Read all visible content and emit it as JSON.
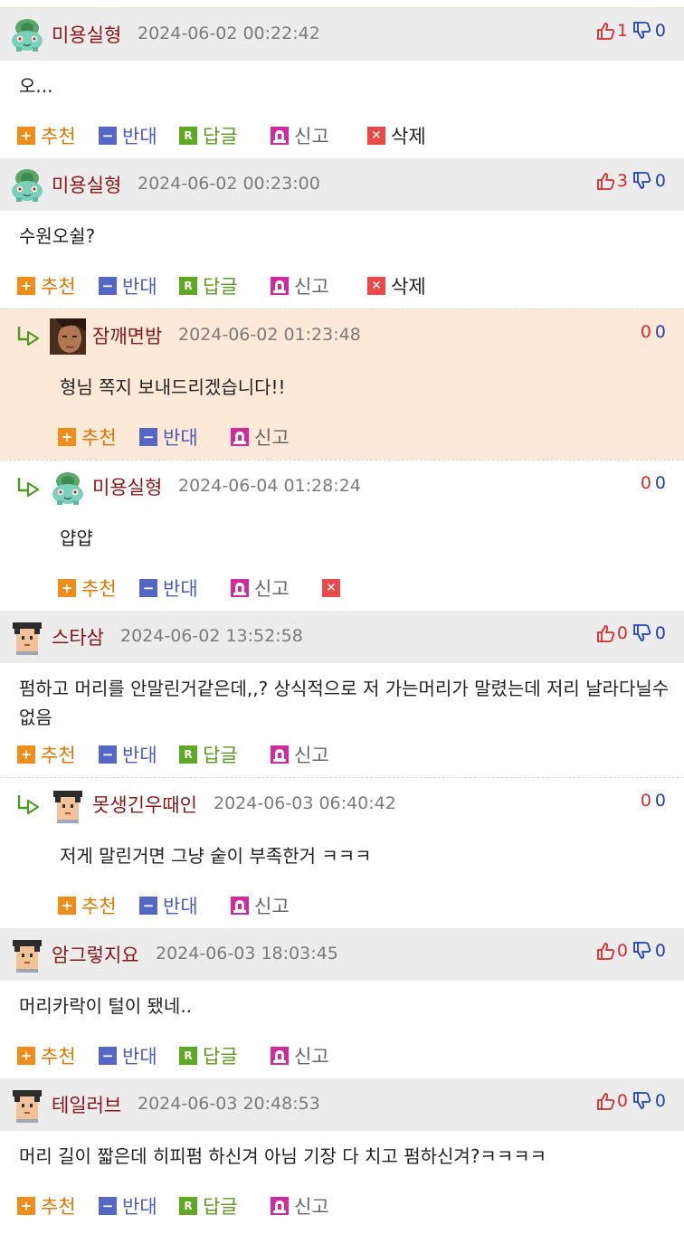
{
  "actions": {
    "recommend": "추천",
    "oppose": "반대",
    "reply": "답글",
    "report": "신고",
    "delete": "삭제"
  },
  "colors": {
    "recommend": "#ef8c1a",
    "oppose": "#5566c4",
    "reply": "#5ea823",
    "report": "#d12a9e",
    "delete": "#e84a4a",
    "nickname": "#8a1515",
    "highlight_bg": "#fde9d7"
  },
  "comments": [
    {
      "nick": "미용실형",
      "date": "2024-06-02 00:22:42",
      "text": "오...",
      "up": "1",
      "down": "0",
      "avatar": "pokemon-avatar-icon",
      "reply": false,
      "highlight": false,
      "showThumbs": true,
      "showReply": true,
      "del": "label"
    },
    {
      "nick": "미용실형",
      "date": "2024-06-02 00:23:00",
      "text": "수원오쉴?",
      "up": "3",
      "down": "0",
      "avatar": "pokemon-avatar-icon",
      "reply": false,
      "highlight": false,
      "showThumbs": true,
      "showReply": true,
      "del": "label"
    },
    {
      "nick": "잠깨면밤",
      "date": "2024-06-02 01:23:48",
      "text": "형님 쪽지 보내드리겠습니다!!",
      "up": "0",
      "down": "0",
      "avatar": "photo-avatar-icon",
      "reply": true,
      "highlight": true,
      "showThumbs": false,
      "showReply": false,
      "del": "none"
    },
    {
      "nick": "미용실형",
      "date": "2024-06-04 01:28:24",
      "text": "얍얍",
      "up": "0",
      "down": "0",
      "avatar": "pokemon-avatar-icon",
      "reply": true,
      "highlight": false,
      "showThumbs": false,
      "showReply": false,
      "del": "icon"
    },
    {
      "nick": "스타삼",
      "date": "2024-06-02 13:52:58",
      "text": "펌하고 머리를 안말린거같은데,,? 상식적으로 저 가는머리가 말렸는데 저리 날라다닐수 없음",
      "up": "0",
      "down": "0",
      "avatar": "pixel-person-avatar-icon",
      "reply": false,
      "highlight": false,
      "showThumbs": true,
      "showReply": true,
      "del": "none"
    },
    {
      "nick": "못생긴우때인",
      "date": "2024-06-03 06:40:42",
      "text": "저게 말린거면 그냥 숱이 부족한거 ㅋㅋㅋ",
      "up": "0",
      "down": "0",
      "avatar": "pixel-person-avatar-icon",
      "reply": true,
      "highlight": false,
      "showThumbs": false,
      "showReply": false,
      "del": "none"
    },
    {
      "nick": "암그렇지요",
      "date": "2024-06-03 18:03:45",
      "text": "머리카락이 털이 됐네..",
      "up": "0",
      "down": "0",
      "avatar": "pixel-person-avatar-icon",
      "reply": false,
      "highlight": false,
      "showThumbs": true,
      "showReply": true,
      "del": "none"
    },
    {
      "nick": "테일러브",
      "date": "2024-06-03 20:48:53",
      "text": "머리 길이 짧은데 히피펌 하신겨 아님 기장 다 치고 펌하신겨?ㅋㅋㅋㅋ",
      "up": "0",
      "down": "0",
      "avatar": "pixel-person-avatar-icon",
      "reply": false,
      "highlight": false,
      "showThumbs": true,
      "showReply": true,
      "del": "none"
    }
  ]
}
